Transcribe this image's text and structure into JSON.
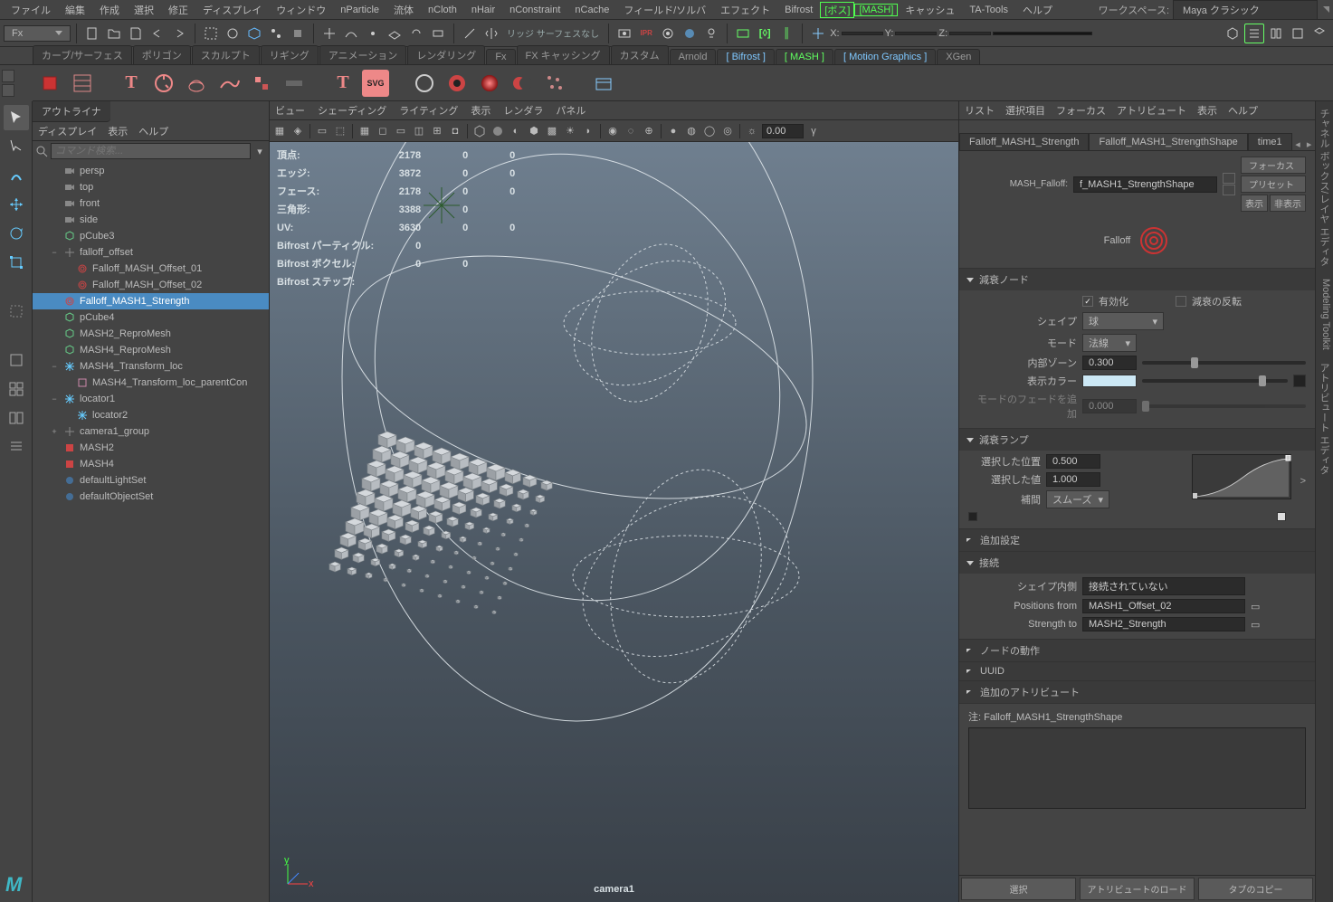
{
  "menubar": {
    "items": [
      "ファイル",
      "編集",
      "作成",
      "選択",
      "修正",
      "ディスプレイ",
      "ウィンドウ",
      "nParticle",
      "流体",
      "nCloth",
      "nHair",
      "nConstraint",
      "nCache",
      "フィールド/ソルバ",
      "エフェクト",
      "Bifrost"
    ],
    "highlights": [
      "ボス",
      "MASH"
    ],
    "items2": [
      "キャッシュ",
      "TA-Tools",
      "ヘルプ"
    ],
    "workspace_label": "ワークスペース:",
    "workspace_value": "Maya クラシック"
  },
  "toolbar": {
    "mode": "Fx",
    "render_label": "リッジ サーフェスなし",
    "axis_x": "X:",
    "axis_y": "Y:",
    "axis_z": "Z:",
    "no_sel": "0.00"
  },
  "shelftabs": {
    "tabs": [
      "カーブ/サーフェス",
      "ポリゴン",
      "スカルプト",
      "リギング",
      "アニメーション",
      "レンダリング",
      "Fx",
      "FX キャッシング",
      "カスタム",
      "Arnold"
    ],
    "bracket_tabs": [
      "Bifrost",
      "MASH",
      "Motion Graphics"
    ],
    "last": "XGen"
  },
  "outliner": {
    "title": "アウトライナ",
    "menu": [
      "ディスプレイ",
      "表示",
      "ヘルプ"
    ],
    "search_placeholder": "コマンド検索...",
    "nodes": [
      {
        "label": "persp",
        "icon": "cam",
        "indent": 1
      },
      {
        "label": "top",
        "icon": "cam",
        "indent": 1
      },
      {
        "label": "front",
        "icon": "cam",
        "indent": 1
      },
      {
        "label": "side",
        "icon": "cam",
        "indent": 1
      },
      {
        "label": "pCube3",
        "icon": "mesh",
        "indent": 1
      },
      {
        "label": "falloff_offset",
        "icon": "xform",
        "indent": 1,
        "exp": "−"
      },
      {
        "label": "Falloff_MASH_Offset_01",
        "icon": "falloff",
        "indent": 2
      },
      {
        "label": "Falloff_MASH_Offset_02",
        "icon": "falloff",
        "indent": 2
      },
      {
        "label": "Falloff_MASH1_Strength",
        "icon": "falloff",
        "indent": 1,
        "sel": true
      },
      {
        "label": "pCube4",
        "icon": "mesh",
        "indent": 1
      },
      {
        "label": "MASH2_ReproMesh",
        "icon": "mesh",
        "indent": 1
      },
      {
        "label": "MASH4_ReproMesh",
        "icon": "mesh",
        "indent": 1
      },
      {
        "label": "MASH4_Transform_loc",
        "icon": "loc",
        "indent": 1,
        "exp": "−"
      },
      {
        "label": "MASH4_Transform_loc_parentCon",
        "icon": "con",
        "indent": 2
      },
      {
        "label": "locator1",
        "icon": "loc",
        "indent": 1,
        "exp": "−"
      },
      {
        "label": "locator2",
        "icon": "loc",
        "indent": 2
      },
      {
        "label": "camera1_group",
        "icon": "xform",
        "indent": 1,
        "exp": "+"
      },
      {
        "label": "MASH2",
        "icon": "mash",
        "indent": 1
      },
      {
        "label": "MASH4",
        "icon": "mash",
        "indent": 1
      },
      {
        "label": "defaultLightSet",
        "icon": "set",
        "indent": 1
      },
      {
        "label": "defaultObjectSet",
        "icon": "set",
        "indent": 1
      }
    ]
  },
  "viewport": {
    "menu": [
      "ビュー",
      "シェーディング",
      "ライティング",
      "表示",
      "レンダラ",
      "パネル"
    ],
    "hud_rows": [
      {
        "label": "頂点:",
        "a": "2178",
        "b": "0",
        "c": "0"
      },
      {
        "label": "エッジ:",
        "a": "3872",
        "b": "0",
        "c": "0"
      },
      {
        "label": "フェース:",
        "a": "2178",
        "b": "0",
        "c": "0"
      },
      {
        "label": "三角形:",
        "a": "3388",
        "b": "0",
        "c": ""
      },
      {
        "label": "UV:",
        "a": "3630",
        "b": "0",
        "c": "0"
      },
      {
        "label": "Bifrost パーティクル:",
        "a": "0",
        "b": "",
        "c": ""
      },
      {
        "label": "Bifrost ボクセル:",
        "a": "0",
        "b": "0",
        "c": ""
      },
      {
        "label": "Bifrost ステップ:",
        "a": "",
        "b": "",
        "c": ""
      }
    ],
    "camera": "camera1"
  },
  "attr": {
    "menu": [
      "リスト",
      "選択項目",
      "フォーカス",
      "アトリビュート",
      "表示",
      "ヘルプ"
    ],
    "tabs": [
      "Falloff_MASH1_Strength",
      "Falloff_MASH1_StrengthShape",
      "time1"
    ],
    "active_tab": 1,
    "node_label": "MASH_Falloff:",
    "node_name": "f_MASH1_StrengthShape",
    "btn_focus": "フォーカス",
    "btn_preset": "プリセット",
    "btn_show": "表示",
    "btn_hide": "非表示",
    "falloff_label": "Falloff",
    "sec_decay": "減衰ノード",
    "enable": "有効化",
    "invert": "減衰の反転",
    "shape_lbl": "シェイプ",
    "shape_val": "球",
    "mode_lbl": "モード",
    "mode_val": "法線",
    "inner_lbl": "内部ゾーン",
    "inner_val": "0.300",
    "color_lbl": "表示カラー",
    "fade_lbl": "モードのフェードを追加",
    "fade_val": "0.000",
    "sec_ramp": "減衰ランプ",
    "sel_pos_lbl": "選択した位置",
    "sel_pos": "0.500",
    "sel_val_lbl": "選択した値",
    "sel_val": "1.000",
    "interp_lbl": "補間",
    "interp_val": "スムーズ",
    "sec_extra": "追加設定",
    "sec_conn": "接続",
    "shape_in_lbl": "シェイプ内側",
    "shape_in_val": "接続されていない",
    "pos_from_lbl": "Positions from",
    "pos_from_val": "MASH1_Offset_02",
    "str_to_lbl": "Strength to",
    "str_to_val": "MASH2_Strength",
    "sec_nodebeh": "ノードの動作",
    "sec_uuid": "UUID",
    "sec_addattr": "追加のアトリビュート",
    "notes_lbl": "注:  Falloff_MASH1_StrengthShape",
    "foot_select": "選択",
    "foot_load": "アトリビュートのロード",
    "foot_copy": "タブのコピー"
  },
  "rightrail": [
    "チャネル ボックス/レイヤ エディタ",
    "Modeling Toolkit",
    "アトリビュート エディタ"
  ]
}
